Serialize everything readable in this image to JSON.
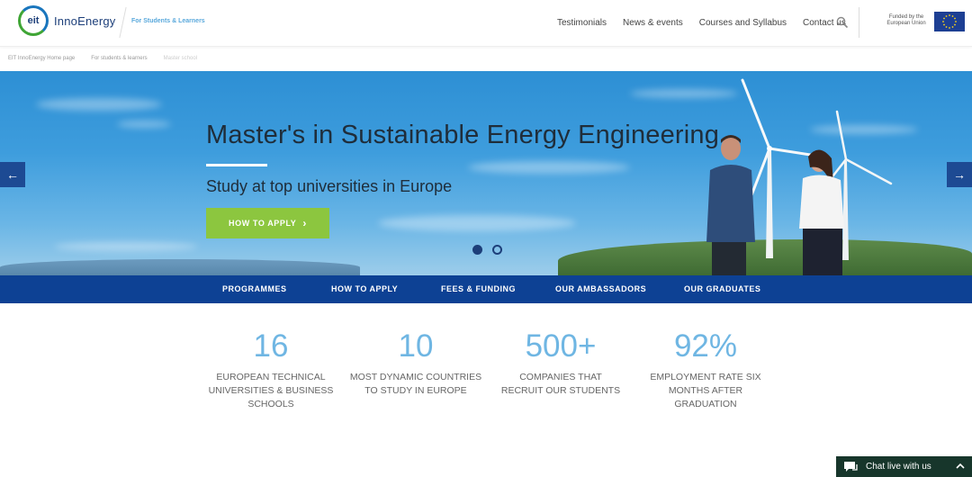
{
  "header": {
    "logo_mark": "eit",
    "logo_name": "InnoEnergy",
    "logo_sub": "For Students & Learners",
    "nav": [
      "Testimonials",
      "News & events",
      "Courses and Syllabus",
      "Contact us"
    ],
    "funded_line1": "Funded by the",
    "funded_line2": "European Union"
  },
  "breadcrumb": [
    "EIT InnoEnergy Home page",
    "For students & learners",
    "Master school"
  ],
  "hero": {
    "title": "Master's in Sustainable Energy Engineering",
    "subtitle": "Study at top universities in Europe",
    "cta": "HOW TO APPLY",
    "cta_chevron": "›",
    "slide_count": 2,
    "active_slide": 1,
    "prev_arrow": "←",
    "next_arrow": "→"
  },
  "subnav": [
    "PROGRAMMES",
    "HOW TO APPLY",
    "FEES & FUNDING",
    "OUR AMBASSADORS",
    "OUR GRADUATES"
  ],
  "stats": [
    {
      "value": "16",
      "label": "EUROPEAN TECHNICAL UNIVERSITIES & BUSINESS SCHOOLS"
    },
    {
      "value": "10",
      "label": "MOST DYNAMIC COUNTRIES TO STUDY IN EUROPE"
    },
    {
      "value": "500+",
      "label": "COMPANIES THAT RECRUIT OUR STUDENTS"
    },
    {
      "value": "92%",
      "label": "EMPLOYMENT RATE SIX MONTHS AFTER GRADUATION"
    }
  ],
  "chat": {
    "label": "Chat live with us"
  },
  "colors": {
    "brand_blue": "#0d4194",
    "accent_green": "#8cc63f",
    "stat_blue": "#6fb6e3",
    "chat_bg": "#17362b"
  },
  "icons": {
    "search": "search-icon",
    "eu_flag": "eu-flag-icon",
    "chat": "chat-bubble-icon",
    "chevron_up": "chevron-up-icon"
  }
}
